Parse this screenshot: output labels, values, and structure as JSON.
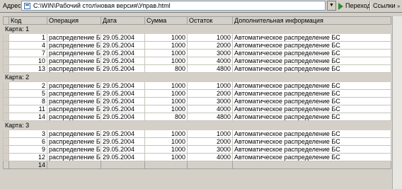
{
  "address_bar": {
    "label": "Адрес",
    "url": "C:\\WIN\\Рабочий стол\\новая версия\\Управ.html",
    "go_label": "Переход",
    "links_label": "Ссылки"
  },
  "table": {
    "columns": [
      "Код",
      "Операция",
      "Дата",
      "Сумма",
      "Остаток",
      "Дополнительная информация"
    ],
    "groups": [
      {
        "title": "Карта: 1",
        "rows": [
          {
            "code": "1",
            "operation": "распределение БС",
            "date": "29.05.2004",
            "sum": "1000",
            "balance": "1000",
            "info": "Автоматическое распределение БС"
          },
          {
            "code": "4",
            "operation": "распределение БС",
            "date": "29.05.2004",
            "sum": "1000",
            "balance": "2000",
            "info": "Автоматическое распределение БС"
          },
          {
            "code": "7",
            "operation": "распределение БС",
            "date": "29.05.2004",
            "sum": "1000",
            "balance": "3000",
            "info": "Автоматическое распределение БС"
          },
          {
            "code": "10",
            "operation": "распределение БС",
            "date": "29.05.2004",
            "sum": "1000",
            "balance": "4000",
            "info": "Автоматическое распределение БС"
          },
          {
            "code": "13",
            "operation": "распределение БС",
            "date": "29.05.2004",
            "sum": "800",
            "balance": "4800",
            "info": "Автоматическое распределение БС"
          }
        ]
      },
      {
        "title": "Карта: 2",
        "rows": [
          {
            "code": "2",
            "operation": "распределение БС",
            "date": "29.05.2004",
            "sum": "1000",
            "balance": "1000",
            "info": "Автоматическое распределение БС"
          },
          {
            "code": "5",
            "operation": "распределение БС",
            "date": "29.05.2004",
            "sum": "1000",
            "balance": "2000",
            "info": "Автоматическое распределение БС"
          },
          {
            "code": "8",
            "operation": "распределение БС",
            "date": "29.05.2004",
            "sum": "1000",
            "balance": "3000",
            "info": "Автоматическое распределение БС"
          },
          {
            "code": "11",
            "operation": "распределение БС",
            "date": "29.05.2004",
            "sum": "1000",
            "balance": "4000",
            "info": "Автоматическое распределение БС"
          },
          {
            "code": "14",
            "operation": "распределение БС",
            "date": "29.05.2004",
            "sum": "800",
            "balance": "4800",
            "info": "Автоматическое распределение БС"
          }
        ]
      },
      {
        "title": "Карта: 3",
        "rows": [
          {
            "code": "3",
            "operation": "распределение БС",
            "date": "29.05.2004",
            "sum": "1000",
            "balance": "1000",
            "info": "Автоматическое распределение БС"
          },
          {
            "code": "6",
            "operation": "распределение БС",
            "date": "29.05.2004",
            "sum": "1000",
            "balance": "2000",
            "info": "Автоматическое распределение БС"
          },
          {
            "code": "9",
            "operation": "распределение БС",
            "date": "29.05.2004",
            "sum": "1000",
            "balance": "3000",
            "info": "Автоматическое распределение БС"
          },
          {
            "code": "12",
            "operation": "распределение БС",
            "date": "29.05.2004",
            "sum": "1000",
            "balance": "4000",
            "info": "Автоматическое распределение БС"
          }
        ]
      }
    ],
    "total_count": "14"
  }
}
